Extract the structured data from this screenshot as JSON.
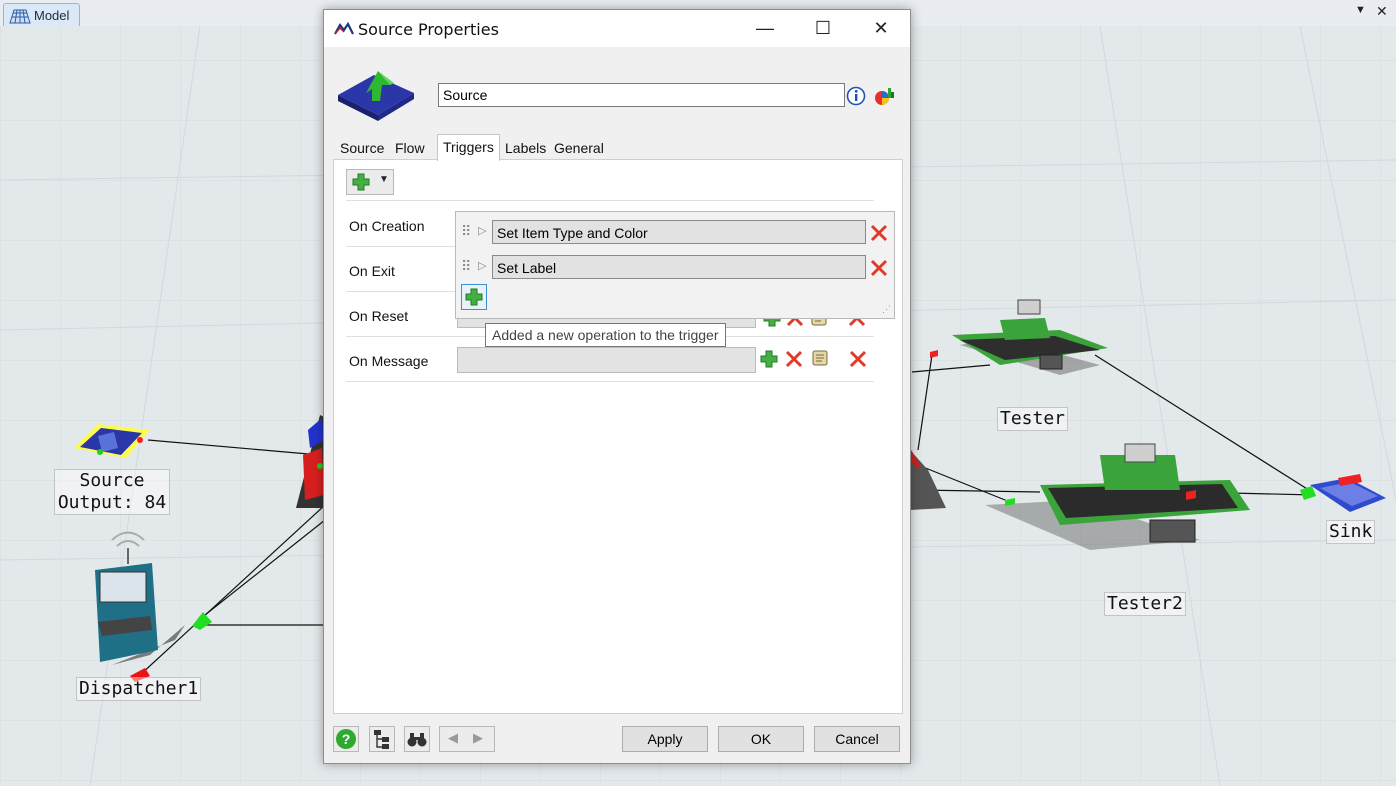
{
  "app": {
    "document_tab": "Model"
  },
  "scene": {
    "labels": {
      "source": "Source\nOutput: 84",
      "dispatcher": "Dispatcher1",
      "tester": "Tester",
      "tester2": "Tester2",
      "sink": "Sink"
    }
  },
  "dialog": {
    "title": "Source  Properties",
    "object_name": "Source",
    "tabs": [
      "Source",
      "Flow",
      "Triggers",
      "Labels",
      "General"
    ],
    "active_tab": "Triggers",
    "triggers": {
      "rows": [
        "On Creation",
        "On Exit",
        "On Reset",
        "On Message"
      ],
      "operations": [
        "Set Item Type and Color",
        "Set Label"
      ],
      "tooltip": "Added a new operation to the trigger"
    },
    "buttons": {
      "apply": "Apply",
      "ok": "OK",
      "cancel": "Cancel"
    }
  },
  "colors": {
    "accent_green": "#3aa43a",
    "delete_red": "#e03a2a",
    "info_blue": "#1f56b5"
  }
}
